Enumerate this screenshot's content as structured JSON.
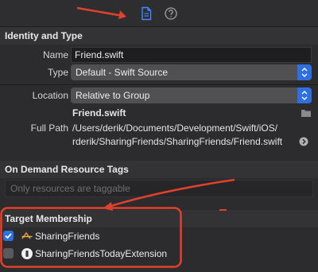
{
  "toolbar": {
    "icons": [
      "file-inspector-icon",
      "quick-help-icon"
    ]
  },
  "identity": {
    "heading": "Identity and Type",
    "name_label": "Name",
    "name_value": "Friend.swift",
    "type_label": "Type",
    "type_value": "Default - Swift Source",
    "location_label": "Location",
    "location_value": "Relative to Group",
    "location_file": "Friend.swift",
    "fullpath_label": "Full Path",
    "fullpath_line1": "/Users/derik/Documents/Development/Swift/iOS/",
    "fullpath_line2": "rderik/SharingFriends/SharingFriends/Friend.swift"
  },
  "on_demand": {
    "heading": "On Demand Resource Tags",
    "placeholder": "Only resources are taggable"
  },
  "target_membership": {
    "heading": "Target Membership",
    "targets": [
      {
        "label": "SharingFriends",
        "checked": true,
        "icon": "swift-app-icon"
      },
      {
        "label": "SharingFriendsTodayExtension",
        "checked": false,
        "icon": "extension-icon"
      }
    ]
  },
  "colors": {
    "accent_blue": "#2f6fe0",
    "annotation_red": "#e0412d"
  }
}
